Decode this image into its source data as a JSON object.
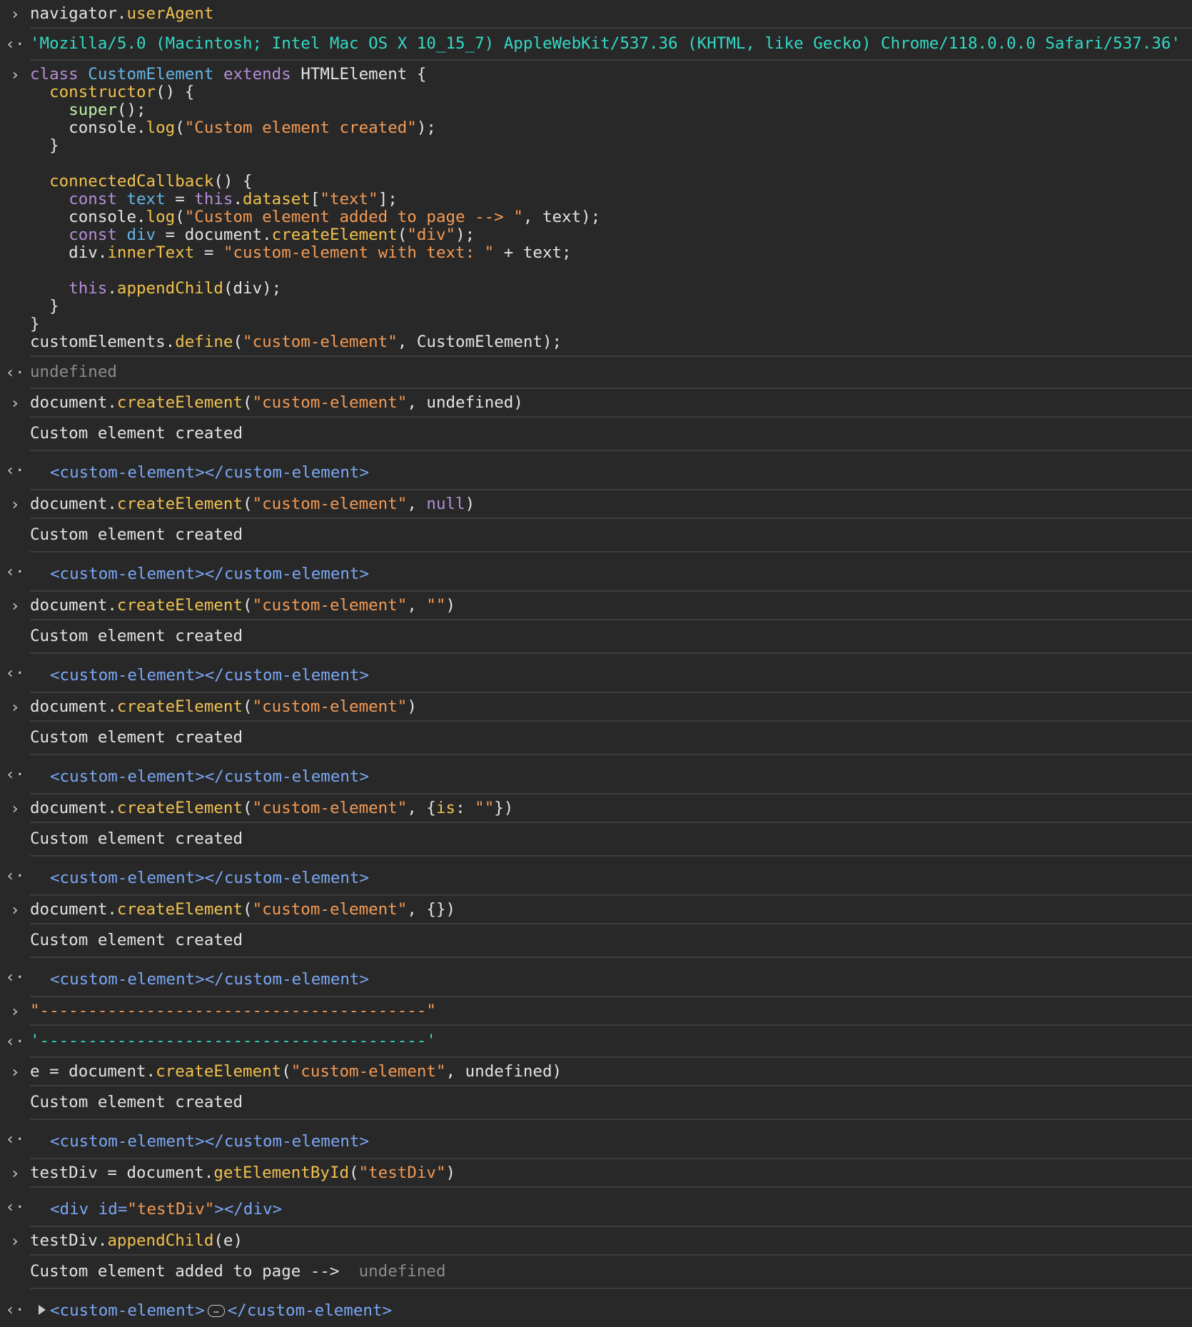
{
  "prompt_glyph": "›",
  "result_glyph": "‹·",
  "ellipsis_glyph": "…",
  "entries": [
    {
      "kind": "input",
      "lines": [
        [
          [
            "plain",
            "navigator."
          ],
          [
            "prop",
            "userAgent"
          ]
        ]
      ]
    },
    {
      "kind": "result",
      "lines": [
        [
          [
            "res",
            "'Mozilla/5.0 (Macintosh; Intel Mac OS X 10_15_7) AppleWebKit/537.36 (KHTML, like Gecko) Chrome/118.0.0.0 Safari/537.36'"
          ]
        ]
      ]
    },
    {
      "kind": "input",
      "lines": [
        [
          [
            "kw",
            "class "
          ],
          [
            "cls",
            "CustomElement "
          ],
          [
            "kw",
            "extends "
          ],
          [
            "plain",
            "HTMLElement {"
          ]
        ],
        [
          [
            "plain",
            "  "
          ],
          [
            "fdecl",
            "constructor"
          ],
          [
            "plain",
            "() {"
          ]
        ],
        [
          [
            "plain",
            "    "
          ],
          [
            "super",
            "super"
          ],
          [
            "plain",
            "();"
          ]
        ],
        [
          [
            "plain",
            "    console."
          ],
          [
            "func",
            "log"
          ],
          [
            "plain",
            "("
          ],
          [
            "str",
            "\"Custom element created\""
          ],
          [
            "plain",
            ");"
          ]
        ],
        [
          [
            "plain",
            "  }"
          ]
        ],
        [
          [
            "plain",
            ""
          ]
        ],
        [
          [
            "plain",
            "  "
          ],
          [
            "fdecl",
            "connectedCallback"
          ],
          [
            "plain",
            "() {"
          ]
        ],
        [
          [
            "plain",
            "    "
          ],
          [
            "kw",
            "const "
          ],
          [
            "var",
            "text"
          ],
          [
            "plain",
            " = "
          ],
          [
            "kw",
            "this"
          ],
          [
            "plain",
            "."
          ],
          [
            "prop",
            "dataset"
          ],
          [
            "plain",
            "["
          ],
          [
            "str",
            "\"text\""
          ],
          [
            "plain",
            "];"
          ]
        ],
        [
          [
            "plain",
            "    console."
          ],
          [
            "func",
            "log"
          ],
          [
            "plain",
            "("
          ],
          [
            "str",
            "\"Custom element added to page --> \""
          ],
          [
            "plain",
            ", text);"
          ]
        ],
        [
          [
            "plain",
            "    "
          ],
          [
            "kw",
            "const "
          ],
          [
            "var",
            "div"
          ],
          [
            "plain",
            " = document."
          ],
          [
            "func",
            "createElement"
          ],
          [
            "plain",
            "("
          ],
          [
            "str",
            "\"div\""
          ],
          [
            "plain",
            ");"
          ]
        ],
        [
          [
            "plain",
            "    div."
          ],
          [
            "prop",
            "innerText"
          ],
          [
            "plain",
            " = "
          ],
          [
            "str",
            "\"custom-element with text: \""
          ],
          [
            "plain",
            " + text;"
          ]
        ],
        [
          [
            "plain",
            ""
          ]
        ],
        [
          [
            "plain",
            "    "
          ],
          [
            "kw",
            "this"
          ],
          [
            "plain",
            "."
          ],
          [
            "func",
            "appendChild"
          ],
          [
            "plain",
            "(div);"
          ]
        ],
        [
          [
            "plain",
            "  }"
          ]
        ],
        [
          [
            "plain",
            "}"
          ]
        ],
        [
          [
            "plain",
            "customElements."
          ],
          [
            "func",
            "define"
          ],
          [
            "plain",
            "("
          ],
          [
            "str",
            "\"custom-element\""
          ],
          [
            "plain",
            ", CustomElement);"
          ]
        ]
      ]
    },
    {
      "kind": "result",
      "lines": [
        [
          [
            "undef",
            "undefined"
          ]
        ]
      ]
    },
    {
      "kind": "input",
      "lines": [
        [
          [
            "plain",
            "document."
          ],
          [
            "func",
            "createElement"
          ],
          [
            "plain",
            "("
          ],
          [
            "str",
            "\"custom-element\""
          ],
          [
            "plain",
            ", undefined)"
          ]
        ]
      ]
    },
    {
      "kind": "log",
      "lines": [
        [
          [
            "log",
            "Custom element created"
          ]
        ]
      ]
    },
    {
      "kind": "result",
      "el": true,
      "lines": [
        [
          [
            "pad",
            ""
          ],
          [
            "tag",
            "<custom-element></custom-element>"
          ]
        ]
      ]
    },
    {
      "kind": "input",
      "lines": [
        [
          [
            "plain",
            "document."
          ],
          [
            "func",
            "createElement"
          ],
          [
            "plain",
            "("
          ],
          [
            "str",
            "\"custom-element\""
          ],
          [
            "plain",
            ", "
          ],
          [
            "kw",
            "null"
          ],
          [
            "plain",
            ")"
          ]
        ]
      ]
    },
    {
      "kind": "log",
      "lines": [
        [
          [
            "log",
            "Custom element created"
          ]
        ]
      ]
    },
    {
      "kind": "result",
      "el": true,
      "lines": [
        [
          [
            "pad",
            ""
          ],
          [
            "tag",
            "<custom-element></custom-element>"
          ]
        ]
      ]
    },
    {
      "kind": "input",
      "lines": [
        [
          [
            "plain",
            "document."
          ],
          [
            "func",
            "createElement"
          ],
          [
            "plain",
            "("
          ],
          [
            "str",
            "\"custom-element\""
          ],
          [
            "plain",
            ", "
          ],
          [
            "str",
            "\"\""
          ],
          [
            "plain",
            ")"
          ]
        ]
      ]
    },
    {
      "kind": "log",
      "lines": [
        [
          [
            "log",
            "Custom element created"
          ]
        ]
      ]
    },
    {
      "kind": "result",
      "el": true,
      "lines": [
        [
          [
            "pad",
            ""
          ],
          [
            "tag",
            "<custom-element></custom-element>"
          ]
        ]
      ]
    },
    {
      "kind": "input",
      "lines": [
        [
          [
            "plain",
            "document."
          ],
          [
            "func",
            "createElement"
          ],
          [
            "plain",
            "("
          ],
          [
            "str",
            "\"custom-element\""
          ],
          [
            "plain",
            ")"
          ]
        ]
      ]
    },
    {
      "kind": "log",
      "lines": [
        [
          [
            "log",
            "Custom element created"
          ]
        ]
      ]
    },
    {
      "kind": "result",
      "el": true,
      "lines": [
        [
          [
            "pad",
            ""
          ],
          [
            "tag",
            "<custom-element></custom-element>"
          ]
        ]
      ]
    },
    {
      "kind": "input",
      "lines": [
        [
          [
            "plain",
            "document."
          ],
          [
            "func",
            "createElement"
          ],
          [
            "plain",
            "("
          ],
          [
            "str",
            "\"custom-element\""
          ],
          [
            "plain",
            ", {"
          ],
          [
            "prop",
            "is"
          ],
          [
            "plain",
            ": "
          ],
          [
            "str",
            "\"\""
          ],
          [
            "plain",
            "})"
          ]
        ]
      ]
    },
    {
      "kind": "log",
      "lines": [
        [
          [
            "log",
            "Custom element created"
          ]
        ]
      ]
    },
    {
      "kind": "result",
      "el": true,
      "lines": [
        [
          [
            "pad",
            ""
          ],
          [
            "tag",
            "<custom-element></custom-element>"
          ]
        ]
      ]
    },
    {
      "kind": "input",
      "lines": [
        [
          [
            "plain",
            "document."
          ],
          [
            "func",
            "createElement"
          ],
          [
            "plain",
            "("
          ],
          [
            "str",
            "\"custom-element\""
          ],
          [
            "plain",
            ", {})"
          ]
        ]
      ]
    },
    {
      "kind": "log",
      "lines": [
        [
          [
            "log",
            "Custom element created"
          ]
        ]
      ]
    },
    {
      "kind": "result",
      "el": true,
      "lines": [
        [
          [
            "pad",
            ""
          ],
          [
            "tag",
            "<custom-element></custom-element>"
          ]
        ]
      ]
    },
    {
      "kind": "input",
      "lines": [
        [
          [
            "str",
            "\"----------------------------------------\""
          ]
        ]
      ]
    },
    {
      "kind": "result",
      "lines": [
        [
          [
            "res",
            "'----------------------------------------'"
          ]
        ]
      ]
    },
    {
      "kind": "input",
      "lines": [
        [
          [
            "plain",
            "e = document."
          ],
          [
            "func",
            "createElement"
          ],
          [
            "plain",
            "("
          ],
          [
            "str",
            "\"custom-element\""
          ],
          [
            "plain",
            ", undefined)"
          ]
        ]
      ]
    },
    {
      "kind": "log",
      "lines": [
        [
          [
            "log",
            "Custom element created"
          ]
        ]
      ]
    },
    {
      "kind": "result",
      "el": true,
      "lines": [
        [
          [
            "pad",
            ""
          ],
          [
            "tag",
            "<custom-element></custom-element>"
          ]
        ]
      ]
    },
    {
      "kind": "input",
      "lines": [
        [
          [
            "plain",
            "testDiv = document."
          ],
          [
            "func",
            "getElementById"
          ],
          [
            "plain",
            "("
          ],
          [
            "str",
            "\"testDiv\""
          ],
          [
            "plain",
            ")"
          ]
        ]
      ]
    },
    {
      "kind": "result",
      "el": true,
      "lines": [
        [
          [
            "pad",
            ""
          ],
          [
            "tag",
            "<div "
          ],
          [
            "attr",
            "id"
          ],
          [
            "tag",
            "="
          ],
          [
            "aval",
            "\"testDiv\""
          ],
          [
            "tag",
            "></div>"
          ]
        ]
      ]
    },
    {
      "kind": "input",
      "lines": [
        [
          [
            "plain",
            "testDiv."
          ],
          [
            "func",
            "appendChild"
          ],
          [
            "plain",
            "(e)"
          ]
        ]
      ]
    },
    {
      "kind": "log",
      "lines": [
        [
          [
            "log",
            "Custom element added to page -->  "
          ],
          [
            "undef",
            "undefined"
          ]
        ]
      ]
    },
    {
      "kind": "result",
      "el": true,
      "last": true,
      "lines": [
        [
          [
            "tri",
            ""
          ],
          [
            "tag",
            "<custom-element>"
          ],
          [
            "ell",
            ""
          ],
          [
            "tag",
            "</custom-element>"
          ]
        ]
      ]
    }
  ]
}
